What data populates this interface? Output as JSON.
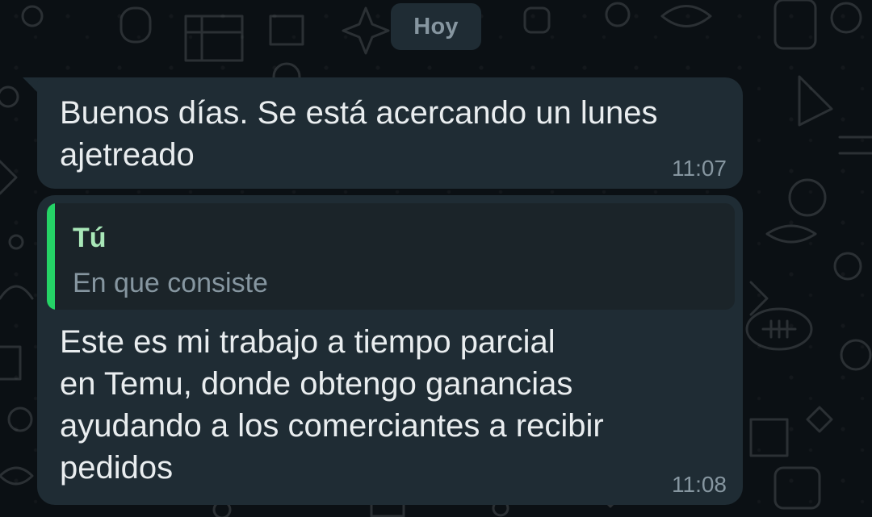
{
  "date_chip": "Hoy",
  "messages": [
    {
      "text": "Buenos días. Se está acercando un lunes\najetreado",
      "time": "11:07"
    },
    {
      "reply": {
        "author": "Tú",
        "text": "En que consiste"
      },
      "text": "Este es mi trabajo a tiempo parcial\nen Temu, donde obtengo ganancias\nayudando a los comerciantes a recibir\npedidos",
      "time": "11:08"
    }
  ],
  "colors": {
    "background": "#0b1014",
    "bubble": "#1f2c34",
    "quote_bar": "#25d366",
    "quote_author": "#a9e7b8",
    "timestamp": "#8696a0"
  },
  "icons": [
    "doodle-pattern-icon"
  ]
}
